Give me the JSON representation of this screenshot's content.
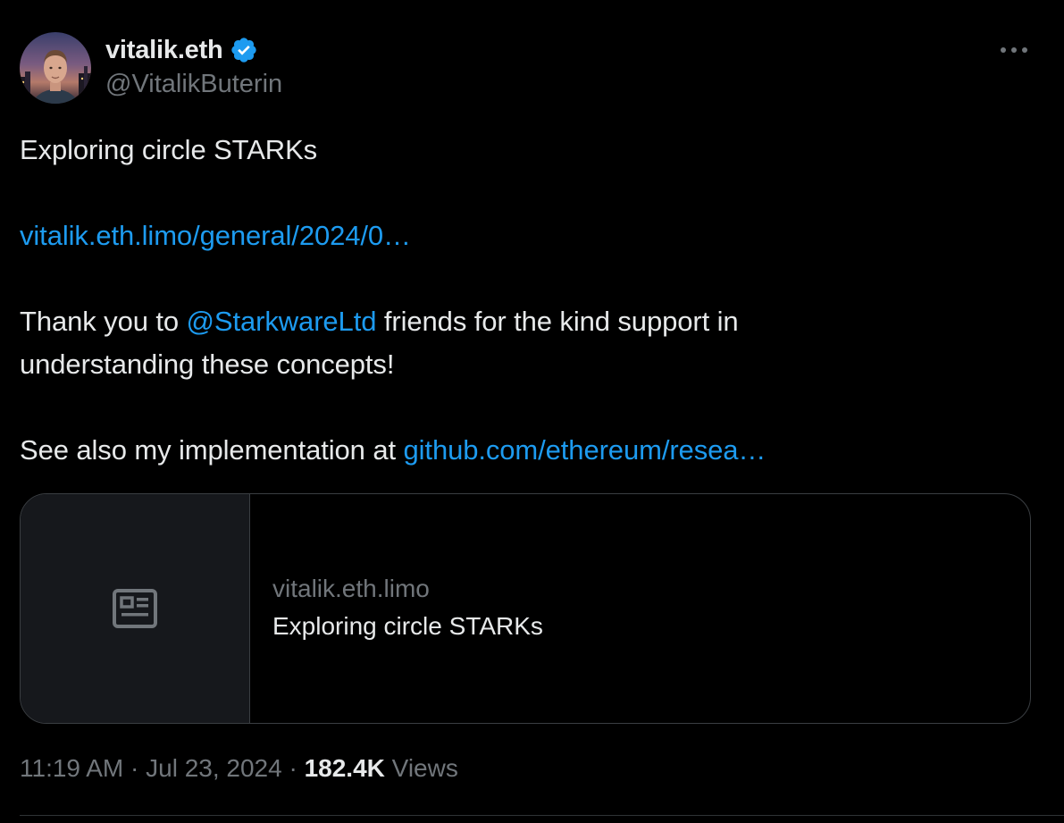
{
  "author": {
    "display_name": "vitalik.eth",
    "handle": "@VitalikButerin",
    "verified": true,
    "avatar_icon": "profile-photo",
    "verified_icon": "verified-badge-icon",
    "verified_color": "#1d9bf0"
  },
  "menu": {
    "more_icon": "more-horizontal-icon"
  },
  "tweet": {
    "line1": "Exploring circle STARKs",
    "link1": "vitalik.eth.limo/general/2024/0…",
    "line3_prefix": "Thank you to ",
    "mention": "@StarkwareLtd",
    "line3_suffix": " friends for the kind support in",
    "line4": "understanding these concepts!",
    "line5_prefix": "See also my implementation at ",
    "link2": "github.com/ethereum/resea…"
  },
  "card": {
    "thumb_icon": "article-icon",
    "domain": "vitalik.eth.limo",
    "title": "Exploring circle STARKs"
  },
  "meta": {
    "time": "11:19 AM",
    "separator": " · ",
    "date": "Jul 23, 2024",
    "views_count": "182.4K",
    "views_label": " Views"
  },
  "colors": {
    "background": "#000000",
    "text": "#e7e9ea",
    "secondary_text": "#71767b",
    "link": "#1d9bf0",
    "border": "#2f3336"
  }
}
